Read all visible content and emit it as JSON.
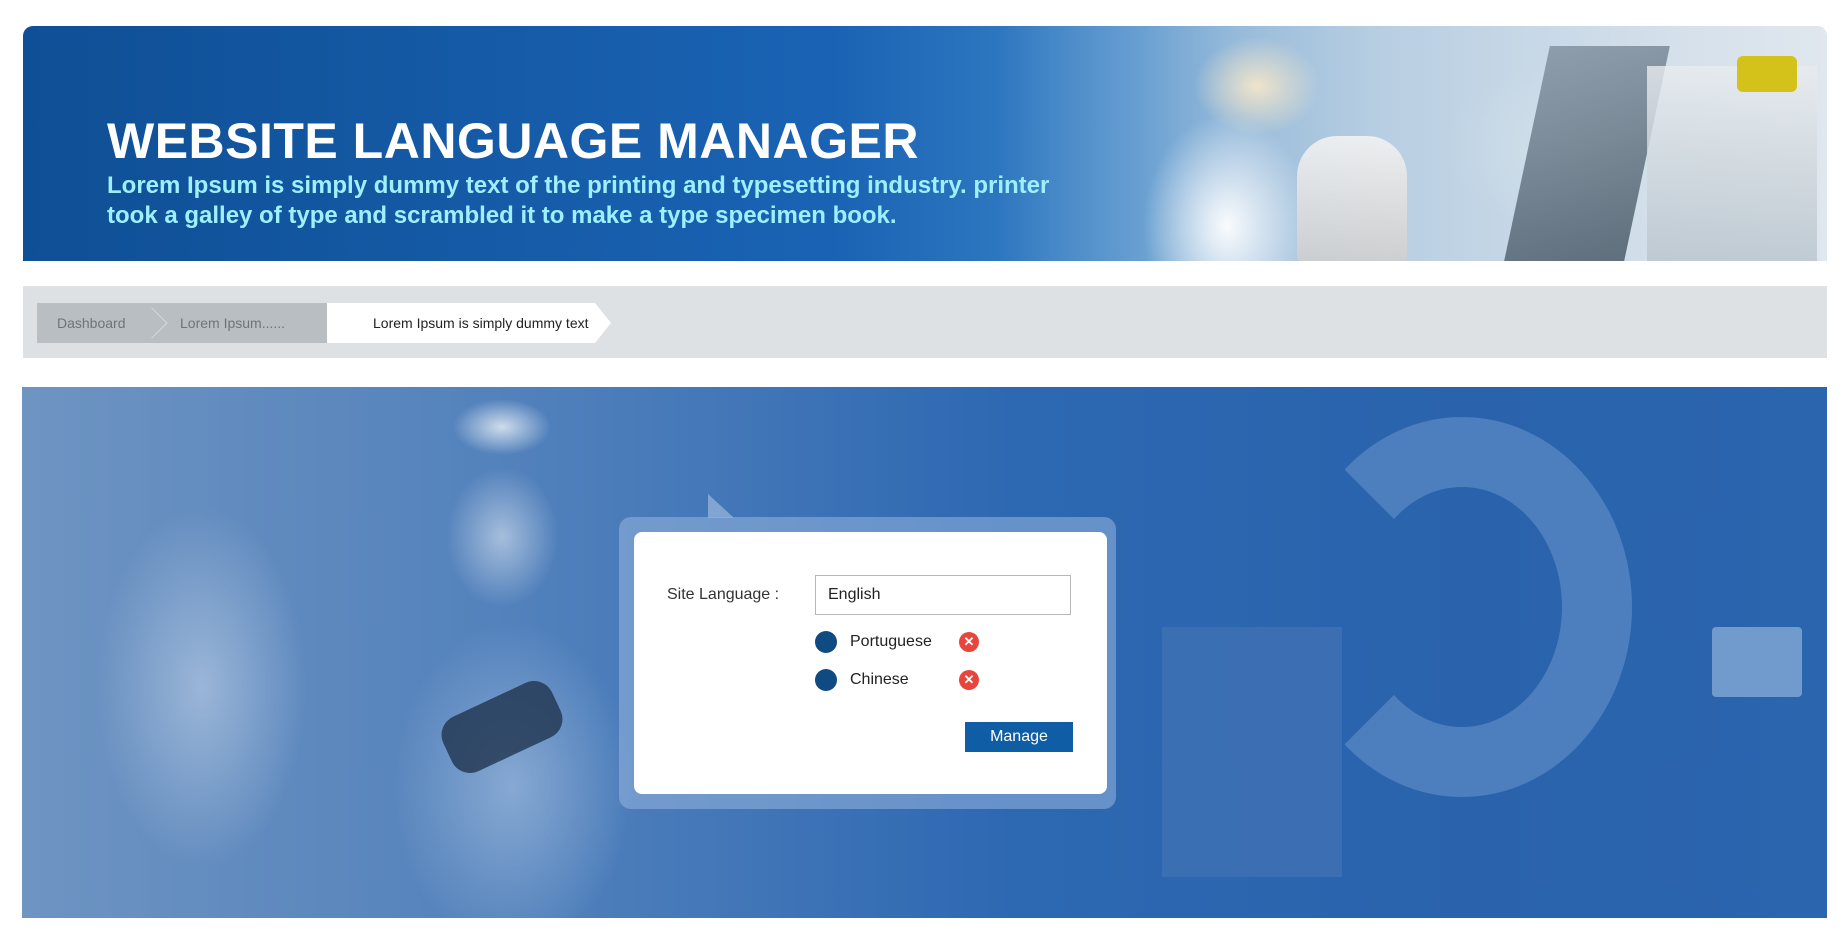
{
  "header": {
    "title": "WEBSITE LANGUAGE MANAGER",
    "subtitle": "Lorem Ipsum is simply dummy text of the printing and typesetting industry. printer took a galley of type and scrambled it to make a type specimen book."
  },
  "breadcrumb": {
    "items": [
      {
        "label": "Dashboard"
      },
      {
        "label": "Lorem Ipsum......"
      },
      {
        "label": "Lorem Ipsum is simply dummy text"
      }
    ]
  },
  "language_form": {
    "site_language_label": "Site Language :",
    "site_language_value": "English",
    "languages": [
      {
        "name": "Portuguese"
      },
      {
        "name": "Chinese"
      }
    ],
    "remove_icon": "close-icon",
    "manage_label": "Manage"
  },
  "colors": {
    "brand_blue": "#0f5da5",
    "dot_blue": "#0f4a82",
    "remove_red": "#e8453c",
    "subtitle_cyan": "#9ef0ff"
  }
}
